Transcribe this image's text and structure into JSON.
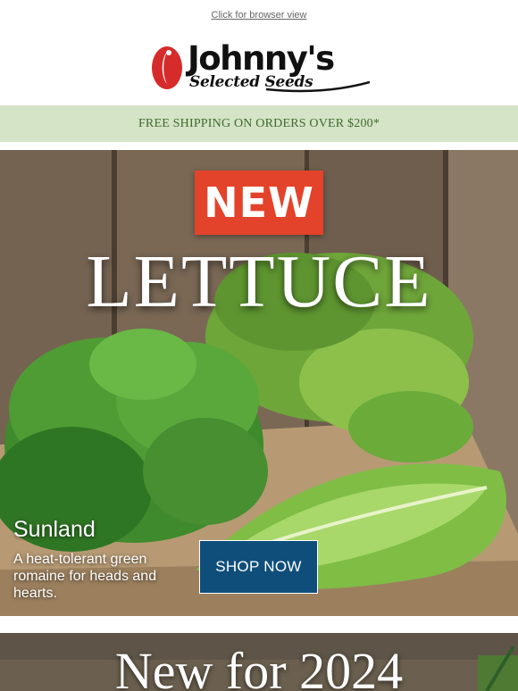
{
  "header": {
    "browser_link": "Click for browser view"
  },
  "logo": {
    "name": "Johnny's",
    "subtitle": "Selected Seeds"
  },
  "promo": {
    "text": "FREE SHIPPING ON ORDERS OVER $200*"
  },
  "hero": {
    "badge": "NEW",
    "title": "LETTUCE",
    "variety_name": "Sunland",
    "variety_description": "A heat-tolerant green romaine for heads and hearts.",
    "cta_label": "SHOP NOW"
  },
  "section2": {
    "title": "New for 2024"
  },
  "colors": {
    "promo_bg": "#d5e3c7",
    "promo_text": "#3f6a2e",
    "badge_bg": "#e3432a",
    "button_bg": "#0f4e7a",
    "logo_red": "#d62b2b"
  }
}
